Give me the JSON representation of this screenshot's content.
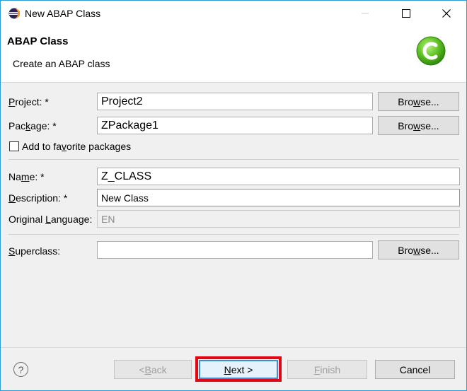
{
  "window": {
    "title": "New ABAP Class"
  },
  "banner": {
    "title": "ABAP Class",
    "description": "Create an ABAP class"
  },
  "form": {
    "project": {
      "label_pre": "",
      "label_mn": "P",
      "label_post": "roject: *",
      "value": "Project2"
    },
    "package": {
      "label_pre": "Pac",
      "label_mn": "k",
      "label_post": "age: *",
      "value": "ZPackage1"
    },
    "favorite": {
      "label_pre": "Add to fa",
      "label_mn": "v",
      "label_post": "orite packages",
      "checked": false
    },
    "name": {
      "label_pre": "Na",
      "label_mn": "m",
      "label_post": "e: *",
      "value": "Z_CLASS"
    },
    "description": {
      "label_pre": "",
      "label_mn": "D",
      "label_post": "escription: *",
      "value": "New Class"
    },
    "language": {
      "label_pre": "Original ",
      "label_mn": "L",
      "label_post": "anguage:",
      "value": "EN"
    },
    "superclass": {
      "label_pre": "",
      "label_mn": "S",
      "label_post": "uperclass:",
      "value": ""
    },
    "browse": {
      "pre": "Bro",
      "mn": "w",
      "post": "se..."
    }
  },
  "footer": {
    "help": "?",
    "back": {
      "pre": "< ",
      "mn": "B",
      "post": "ack"
    },
    "next": {
      "pre": "",
      "mn": "N",
      "post": "ext >"
    },
    "finish": {
      "pre": "",
      "mn": "F",
      "post": "inish"
    },
    "cancel": "Cancel"
  },
  "colors": {
    "accent": "#3c8fd6",
    "highlight": "#e30613",
    "logo": "#5bbf21"
  }
}
